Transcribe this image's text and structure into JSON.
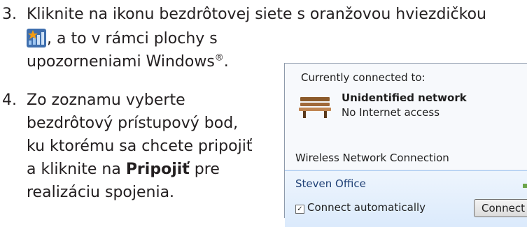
{
  "step3": {
    "number": "3.",
    "line1": "Kliknite na ikonu bezdrôtovej siete s oranžovou hviezdičkou",
    "line2_suffix": ", a to v rámci plochy s",
    "line3_text": "upozorneniami Windows",
    "line3_mark": "®",
    "line3_end": ".",
    "icon": "wireless-network-star-icon"
  },
  "step4": {
    "number": "4.",
    "line1": "Zo zoznamu vyberte",
    "line2": "bezdrôtový prístupový bod,",
    "line3": "ku ktorému sa chcete pripojiť",
    "line4_pre": "a kliknite na ",
    "line4_bold": "Pripojiť",
    "line4_post": " pre",
    "line5": "realizáciu spojenia."
  },
  "popup": {
    "connected_label": "Currently connected to:",
    "network_name": "Unidentified network",
    "network_status": "No Internet access",
    "connection_header": "Wireless Network Connection",
    "available_network": "Steven Office",
    "auto_connect_label": "Connect automatically",
    "auto_connect_checked": "✓",
    "connect_button": "Connect",
    "network_icon": "bench-icon"
  },
  "colors": {
    "text": "#231f20",
    "icon_orange": "#f39c12",
    "selection": "#dbeafc"
  }
}
